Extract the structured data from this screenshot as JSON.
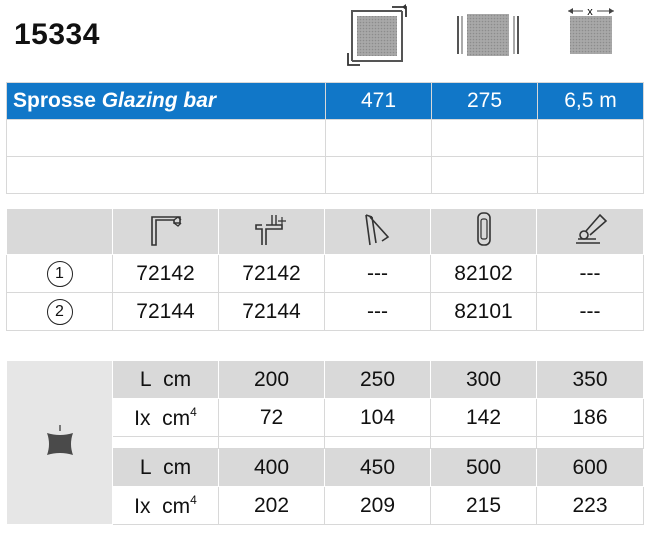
{
  "article": {
    "number": "15334"
  },
  "header_icons": [
    {
      "name": "section-square-icon"
    },
    {
      "name": "section-bars-icon"
    },
    {
      "name": "section-width-icon",
      "label": "x"
    }
  ],
  "spec_row": {
    "name_regular": "Sprosse",
    "name_italic": "Glazing bar",
    "values": [
      "471",
      "275",
      "6,5 m"
    ]
  },
  "profiles": {
    "icons": [
      "gasket-corner-icon",
      "gasket-t-icon",
      "clip-icon",
      "capsule-icon",
      "tool-icon"
    ],
    "rows": [
      {
        "marker": "1",
        "values": [
          "72142",
          "72142",
          "---",
          "82102",
          "---"
        ]
      },
      {
        "marker": "2",
        "values": [
          "72144",
          "72144",
          "---",
          "82101",
          "---"
        ]
      }
    ]
  },
  "inertia": {
    "l_label": "L",
    "l_unit": "cm",
    "ix_label": "Ix",
    "ix_unit": "cm",
    "ix_exp": "4",
    "groups": [
      {
        "L": [
          "200",
          "250",
          "300",
          "350"
        ],
        "Ix": [
          "72",
          "104",
          "142",
          "186"
        ]
      },
      {
        "L": [
          "400",
          "450",
          "500",
          "600"
        ],
        "Ix": [
          "202",
          "209",
          "215",
          "223"
        ]
      }
    ]
  },
  "colors": {
    "accent_blue": "#1177c8",
    "gray_fill": "#d9d9d9"
  }
}
